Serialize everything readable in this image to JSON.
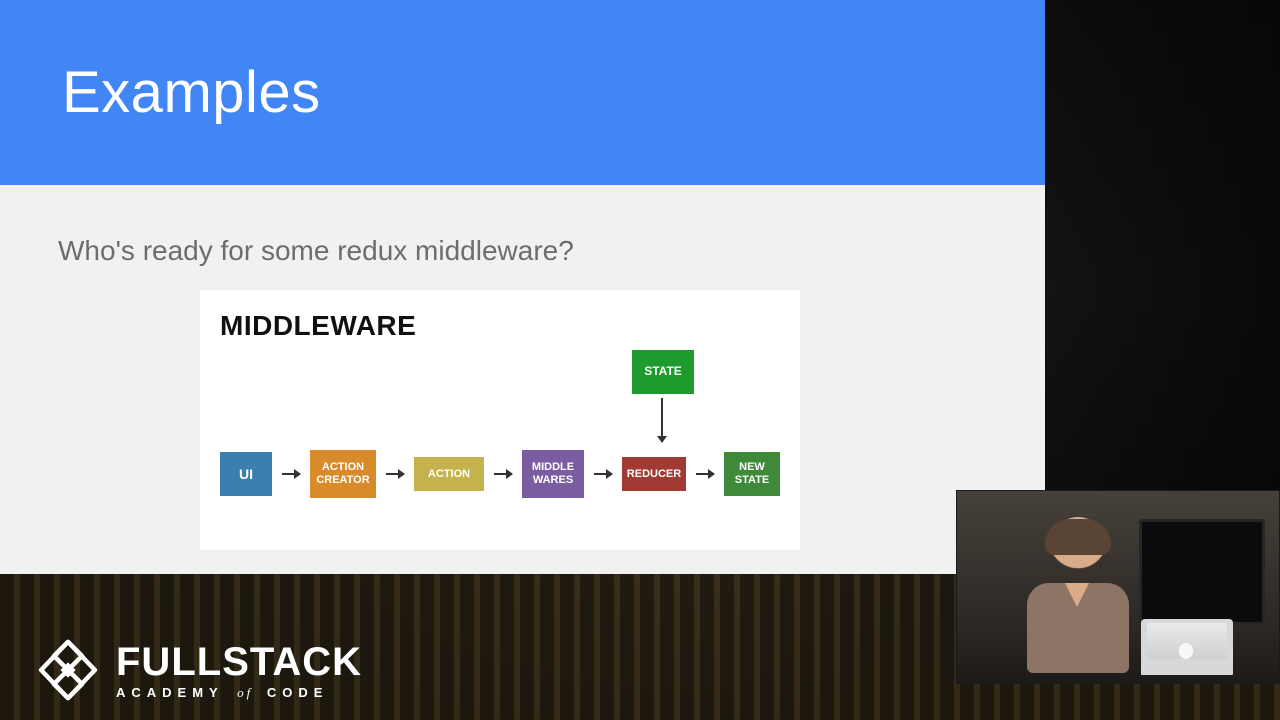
{
  "slide": {
    "title": "Examples",
    "subtitle": "Who's ready for some redux middleware?"
  },
  "diagram": {
    "heading": "MIDDLEWARE",
    "top_box": "STATE",
    "flow": {
      "ui": "UI",
      "action_creator": "ACTION\nCREATOR",
      "action": "ACTION",
      "middle_wares": "MIDDLE\nWARES",
      "reducer": "REDUCER",
      "new_state": "NEW\nSTATE"
    },
    "colors": {
      "ui": "#3a7fb0",
      "action_creator": "#d98a2b",
      "action": "#c6b24d",
      "middle_wares": "#7a5ca0",
      "reducer": "#a03a33",
      "new_state": "#3f8a3a",
      "state": "#1f9a2f"
    }
  },
  "logo": {
    "main": "FULLSTACK",
    "sub_pre": "ACADEMY",
    "sub_of": "of",
    "sub_post": "CODE"
  },
  "meta": {
    "brand_accent": "#4285f4"
  }
}
